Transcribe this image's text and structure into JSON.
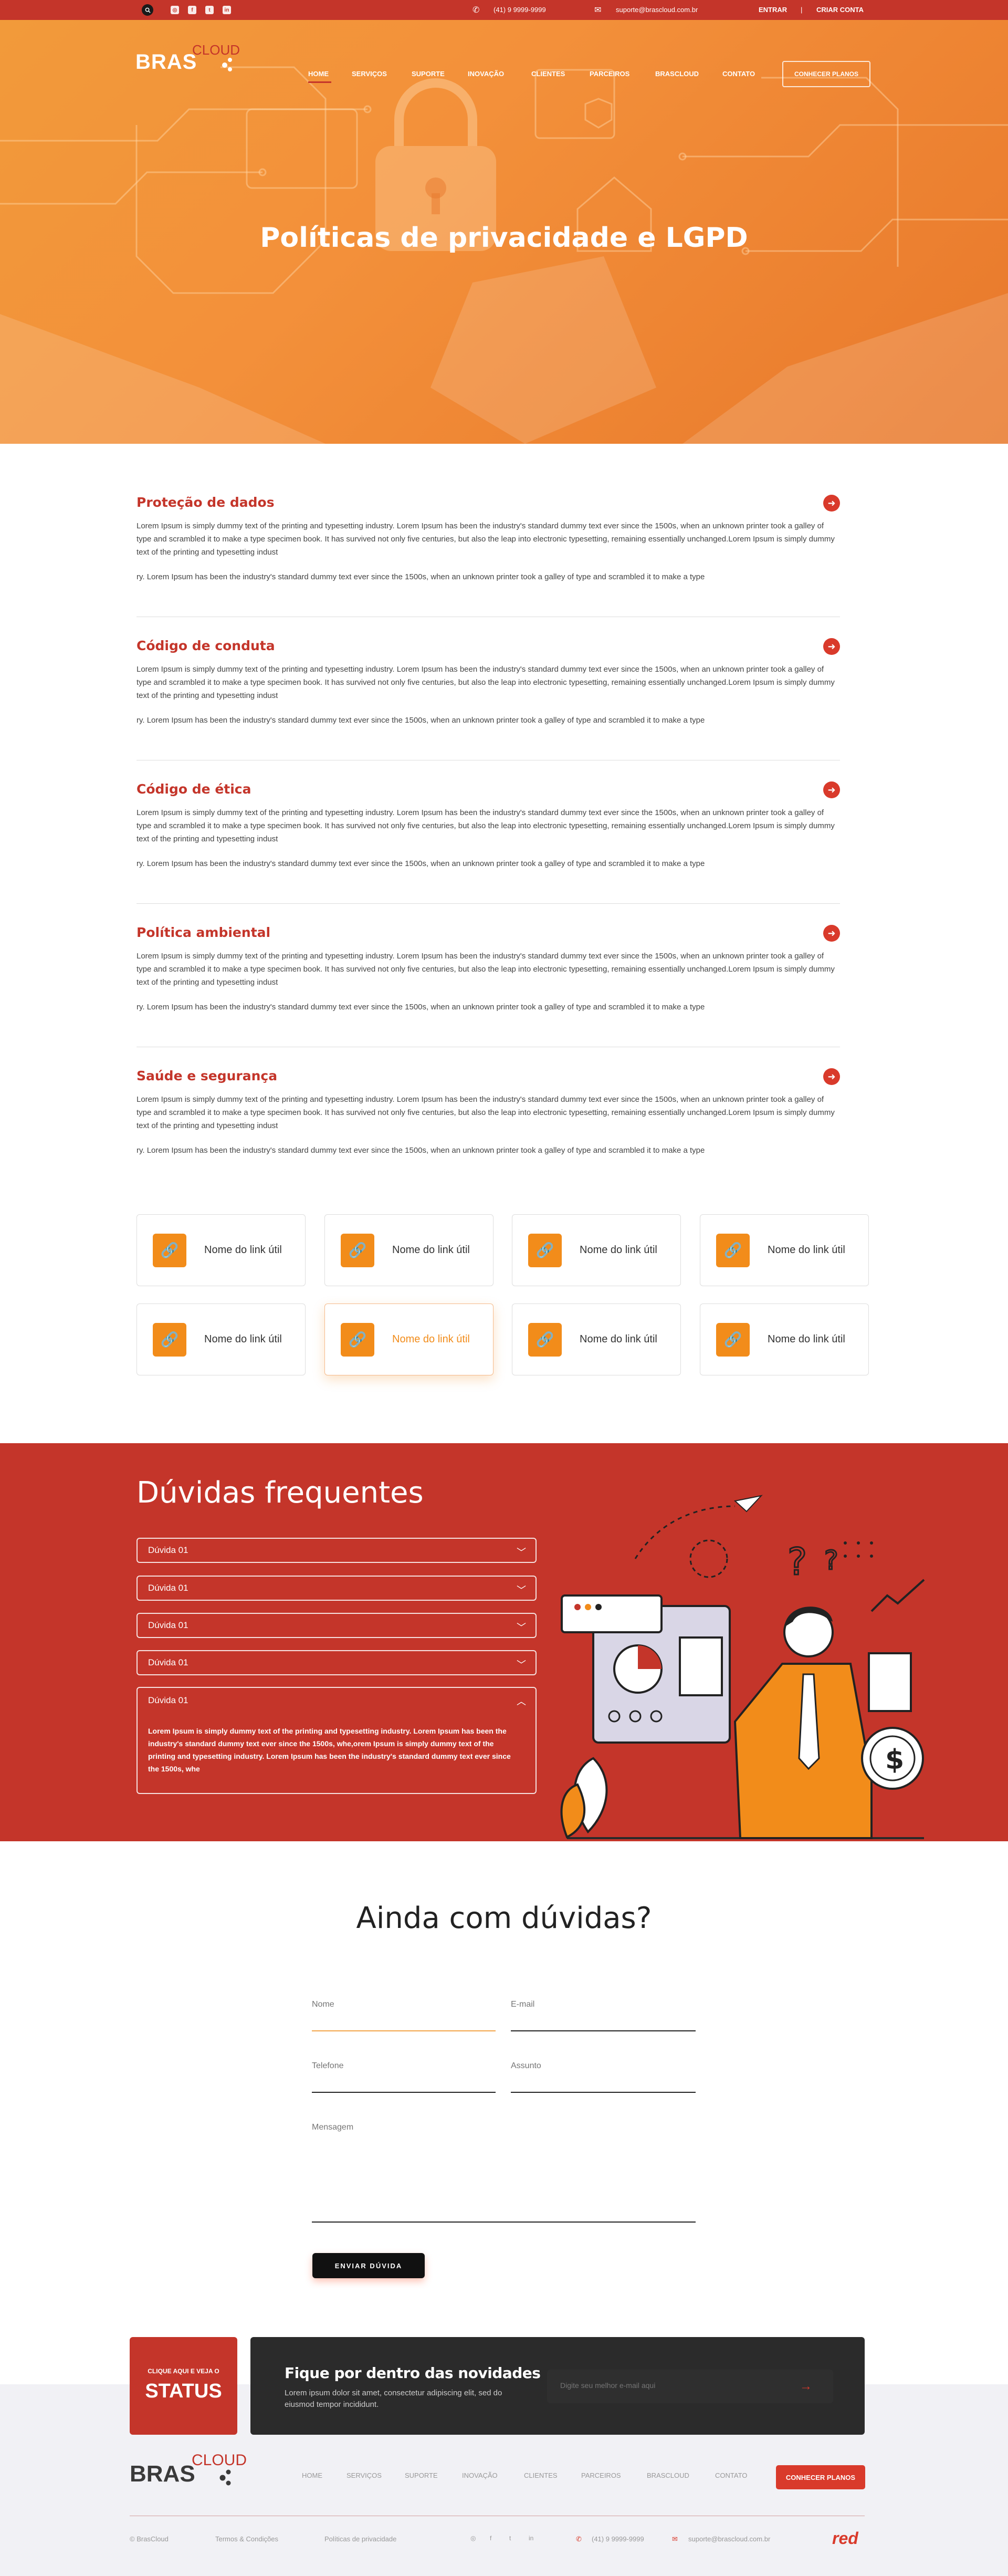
{
  "topbar": {
    "phone": "(41) 9 9999-9999",
    "email": "suporte@brascloud.com.br",
    "login": "ENTRAR",
    "separator": "|",
    "signup": "CRIAR CONTA"
  },
  "logo": {
    "main": "BRAS",
    "sub": "CLOUD"
  },
  "nav": [
    "HOME",
    "SERVIÇOS",
    "SUPORTE",
    "INOVAÇÃO",
    "CLIENTES",
    "PARCEIROS",
    "BRASCLOUD",
    "CONTATO"
  ],
  "nav_cta": "CONHECER PLANOS",
  "hero": {
    "title": "Políticas de privacidade e LGPD"
  },
  "sections": [
    {
      "title": "Proteção de dados",
      "p1": "Lorem Ipsum is simply dummy text of the printing and typesetting industry. Lorem Ipsum has been the industry's standard dummy text ever since the 1500s, when an unknown printer took a galley of type and scrambled it to make a type specimen book. It has survived not only five centuries, but also the leap into electronic typesetting, remaining essentially unchanged.Lorem Ipsum is simply dummy text of the printing and typesetting indust",
      "p2": "ry. Lorem Ipsum has been the industry's standard dummy text ever since the 1500s, when an unknown printer took a galley of type and scrambled it to make a type"
    },
    {
      "title": "Código de conduta",
      "p1": "Lorem Ipsum is simply dummy text of the printing and typesetting industry. Lorem Ipsum has been the industry's standard dummy text ever since the 1500s, when an unknown printer took a galley of type and scrambled it to make a type specimen book. It has survived not only five centuries, but also the leap into electronic typesetting, remaining essentially unchanged.Lorem Ipsum is simply dummy text of the printing and typesetting indust",
      "p2": "ry. Lorem Ipsum has been the industry's standard dummy text ever since the 1500s, when an unknown printer took a galley of type and scrambled it to make a type"
    },
    {
      "title": "Código de ética",
      "p1": "Lorem Ipsum is simply dummy text of the printing and typesetting industry. Lorem Ipsum has been the industry's standard dummy text ever since the 1500s, when an unknown printer took a galley of type and scrambled it to make a type specimen book. It has survived not only five centuries, but also the leap into electronic typesetting, remaining essentially unchanged.Lorem Ipsum is simply dummy text of the printing and typesetting indust",
      "p2": "ry. Lorem Ipsum has been the industry's standard dummy text ever since the 1500s, when an unknown printer took a galley of type and scrambled it to make a type"
    },
    {
      "title": "Política ambiental",
      "p1": "Lorem Ipsum is simply dummy text of the printing and typesetting industry. Lorem Ipsum has been the industry's standard dummy text ever since the 1500s, when an unknown printer took a galley of type and scrambled it to make a type specimen book. It has survived not only five centuries, but also the leap into electronic typesetting, remaining essentially unchanged.Lorem Ipsum is simply dummy text of the printing and typesetting indust",
      "p2": "ry. Lorem Ipsum has been the industry's standard dummy text ever since the 1500s, when an unknown printer took a galley of type and scrambled it to make a type"
    },
    {
      "title": "Saúde e segurança",
      "p1": "Lorem Ipsum is simply dummy text of the printing and typesetting industry. Lorem Ipsum has been the industry's standard dummy text ever since the 1500s, when an unknown printer took a galley of type and scrambled it to make a type specimen book. It has survived not only five centuries, but also the leap into electronic typesetting, remaining essentially unchanged.Lorem Ipsum is simply dummy text of the printing and typesetting indust",
      "p2": "ry. Lorem Ipsum has been the industry's standard dummy text ever since the 1500s, when an unknown printer took a galley of type and scrambled it to make a type"
    }
  ],
  "links": [
    "Nome do link útil",
    "Nome do link útil",
    "Nome do link útil",
    "Nome do link útil",
    "Nome do link útil",
    "Nome do link útil",
    "Nome do link útil",
    "Nome do link útil"
  ],
  "faq": {
    "title": "Dúvidas frequentes",
    "items": [
      "Dúvida 01",
      "Dúvida 01",
      "Dúvida 01",
      "Dúvida 01",
      "Dúvida 01"
    ],
    "answer": "Lorem Ipsum is simply dummy text of the printing and typesetting industry. Lorem Ipsum has been the industry's standard dummy text ever since the 1500s, whe,orem Ipsum is simply dummy text of the printing and typesetting industry. Lorem Ipsum has been the industry's standard dummy text ever since the 1500s, whe"
  },
  "contact": {
    "title": "Ainda com dúvidas?",
    "name_ph": "Nome",
    "email_ph": "E-mail",
    "phone_ph": "Telefone",
    "subject_ph": "Assunto",
    "message_ph": "Mensagem",
    "send": "ENVIAR DÚVIDA"
  },
  "status": {
    "small": "CLIQUE AQUI E VEJA O",
    "big": "STATUS"
  },
  "newsletter": {
    "title": "Fique por dentro das novidades",
    "text": "Lorem ipsum dolor sit amet, consectetur adipiscing elit, sed do eiusmod tempor incididunt.",
    "placeholder": "Digite seu melhor e-mail aqui"
  },
  "footer": {
    "nav": [
      "HOME",
      "SERVIÇOS",
      "SUPORTE",
      "INOVAÇÃO",
      "CLIENTES",
      "PARCEIROS",
      "BRASCLOUD",
      "CONTATO"
    ],
    "cta": "CONHECER PLANOS",
    "copyright": "© BrasCloud",
    "terms": "Termos & Condições",
    "privacy": "Políticas de privacidade",
    "phone": "(41) 9 9999-9999",
    "email": "suporte@brascloud.com.br",
    "brand": "red"
  },
  "colors": {
    "primary": "#c4352a",
    "accent": "#f28c1a",
    "hero": "#f29a3a",
    "dark": "#2b2b2b"
  }
}
